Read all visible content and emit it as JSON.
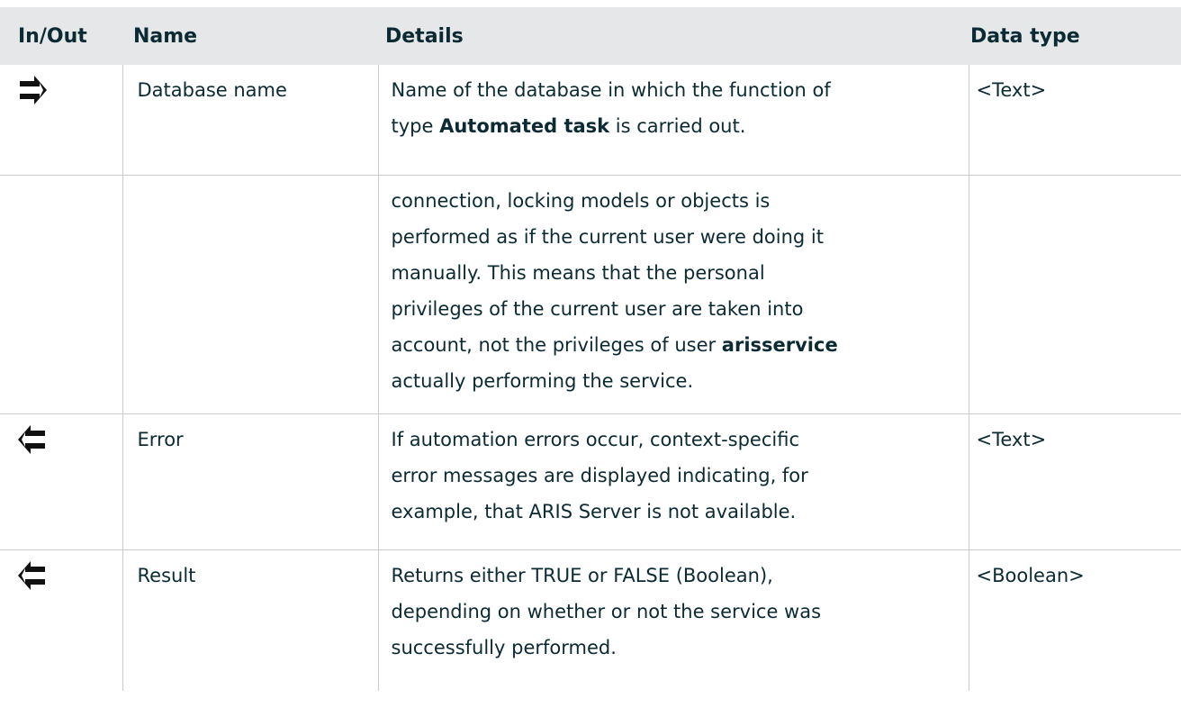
{
  "table": {
    "headers": {
      "in_out": "In/Out",
      "name": "Name",
      "details": "Details",
      "data_type": "Data type"
    },
    "rows": [
      {
        "direction_icon": "arrow-right-icon",
        "name": "Database name",
        "details_lines": [
          "Name of the database in which the function of",
          [
            "type ",
            "Automated task",
            " is carried out."
          ]
        ],
        "data_type": "<Text>"
      },
      {
        "direction_icon": "",
        "name": "",
        "details_lines": [
          "connection, locking models or objects is",
          "performed as if the current user were doing it",
          "manually. This means that the personal",
          "privileges of the current user are taken into",
          [
            "account, not the privileges of user ",
            "arisservice",
            ""
          ],
          "actually performing the service."
        ],
        "data_type": ""
      },
      {
        "direction_icon": "arrow-left-icon",
        "name": "Error",
        "details_lines": [
          "If automation errors occur, context-specific",
          "error messages are displayed indicating, for",
          "example, that ARIS Server is not available."
        ],
        "data_type": "<Text>"
      },
      {
        "direction_icon": "arrow-left-icon",
        "name": "Result",
        "details_lines": [
          "Returns either TRUE or FALSE (Boolean),",
          "depending on whether or not the service was",
          "successfully performed."
        ],
        "data_type": "<Boolean>"
      }
    ]
  },
  "colors": {
    "header_bg": "#e6e7e8",
    "text": "#0b2a33",
    "grid": "#c9cbcd"
  }
}
